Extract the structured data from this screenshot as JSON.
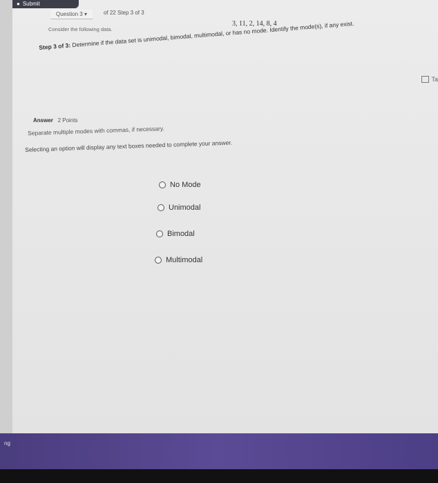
{
  "header": {
    "submit_label": "Submit"
  },
  "question_nav": {
    "question_label": "Question 3",
    "of_label": "of 22 Step 3 of 3"
  },
  "prompt": {
    "consider": "Consider the following data.",
    "dataset": "3, 11, 2, 14, 8, 4"
  },
  "step": {
    "bold": "Step 3 of 3:",
    "text": "Determine if the data set is unimodal, bimodal, multimodal, or has no mode. Identify the mode(s), if any exist."
  },
  "tabs_label": "Ta",
  "answer": {
    "label": "Answer",
    "points": "2 Points",
    "hint_separate": "Separate multiple modes with commas, if necessary.",
    "hint_select": "Selecting an option will display any text boxes needed to complete your answer.",
    "options": [
      "No Mode",
      "Unimodal",
      "Bimodal",
      "Multimodal"
    ]
  },
  "footer": {
    "corner_text": "ng"
  }
}
